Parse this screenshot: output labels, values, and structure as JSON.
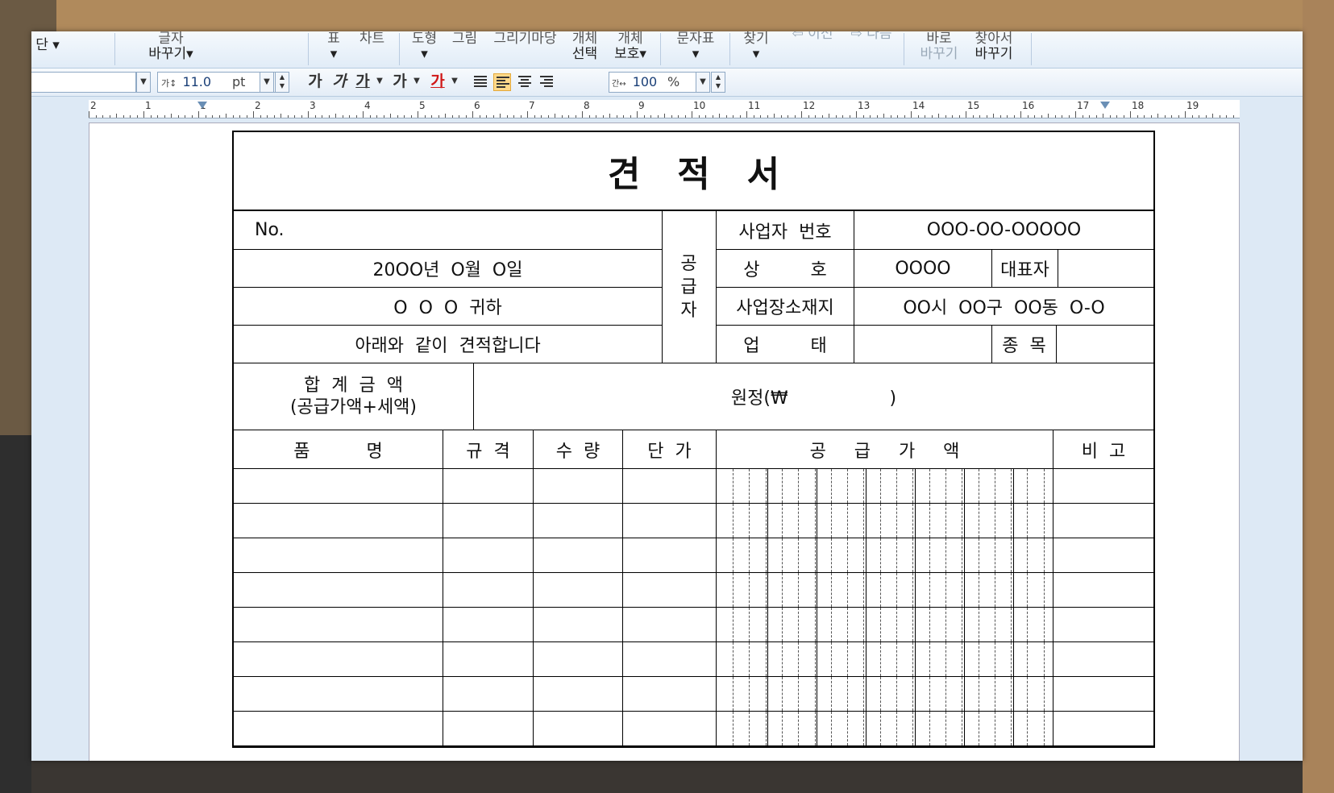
{
  "ribbon": {
    "items": [
      {
        "l1": "",
        "l2": "단 ▾"
      },
      {
        "l1": "글자",
        "l2": "바꾸기▾"
      },
      {
        "l1": "표",
        "l2": "▾"
      },
      {
        "l1": "차트",
        "l2": ""
      },
      {
        "l1": "도형",
        "l2": "▾"
      },
      {
        "l1": "그림",
        "l2": ""
      },
      {
        "l1": "그리기마당",
        "l2": ""
      },
      {
        "l1": "개체",
        "l2": "선택"
      },
      {
        "l1": "개체",
        "l2": "보호▾"
      },
      {
        "l1": "문자표",
        "l2": "▾"
      },
      {
        "l1": "찾기",
        "l2": "▾"
      },
      {
        "l1": "",
        "l2": "⇦ 이전"
      },
      {
        "l1": "",
        "l2": "⇨ 다음"
      },
      {
        "l1": "바로",
        "l2": "바꾸기"
      },
      {
        "l1": "찾아서",
        "l2": "바꾸기"
      }
    ]
  },
  "format": {
    "font_size": "11.0",
    "unit": "pt",
    "bold": "가",
    "italic": "가",
    "underline": "가",
    "strike": "가",
    "color": "가",
    "zoom": "100",
    "zoom_unit": "%"
  },
  "ruler": {
    "numbers": [
      "2",
      "1",
      "1",
      "2",
      "3",
      "4",
      "5",
      "6",
      "7",
      "8",
      "9",
      "10",
      "11",
      "12",
      "13",
      "14",
      "15",
      "16",
      "17",
      "18",
      "19"
    ]
  },
  "document": {
    "title": "견   적   서",
    "no": "No.",
    "date": "20OO년  O월  O일",
    "recipient": "O  O  O  귀하",
    "statement": "아래와  같이  견적합니다",
    "supplier_label": "공\n급\n자",
    "biz_no_label": "사업자  번호",
    "biz_no_value": "OOO-OO-OOOOO",
    "company_label": "상         호",
    "company_value": "OOOO",
    "rep_label": "대표자",
    "address_label": "사업장소재지",
    "address_value": "OO시  OO구  OO동  O-O",
    "biz_type_label": "업         태",
    "item_label": "종  목",
    "total_label_1": "합  계  금  액",
    "total_label_2": "(공급가액+세액)",
    "total_value": "원정(₩                  )",
    "col_item": "품          명",
    "col_spec": "규  격",
    "col_qty": "수  량",
    "col_price": "단  가",
    "col_supply": "공     급     가     액",
    "col_note": "비  고"
  }
}
